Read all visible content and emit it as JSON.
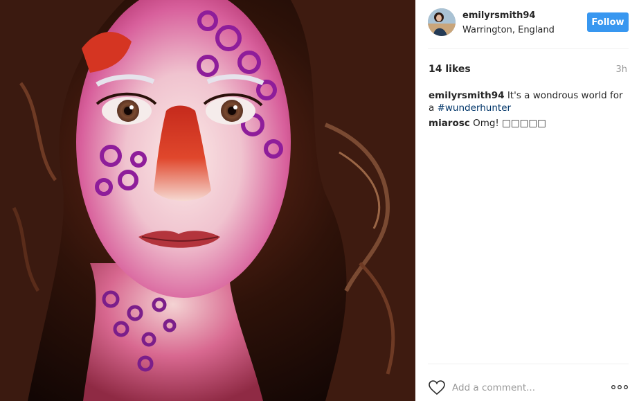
{
  "post": {
    "username": "emilyrsmith94",
    "location": "Warrington, England",
    "follow_label": "Follow",
    "likes": "14 likes",
    "time": "3h",
    "caption": {
      "user": "emilyrsmith94",
      "text": "It's a wondrous world for a",
      "hashtag": "#wunderhunter"
    },
    "comments": [
      {
        "user": "miarosc",
        "text": "Omg! □□□□□"
      }
    ],
    "add_comment_placeholder": "Add a comment..."
  },
  "icons": {
    "like": "heart-outline-icon",
    "more": "more-options-icon"
  },
  "colors": {
    "accent": "#3897f0",
    "hashtag": "#003569",
    "muted": "#999999",
    "text": "#262626"
  }
}
